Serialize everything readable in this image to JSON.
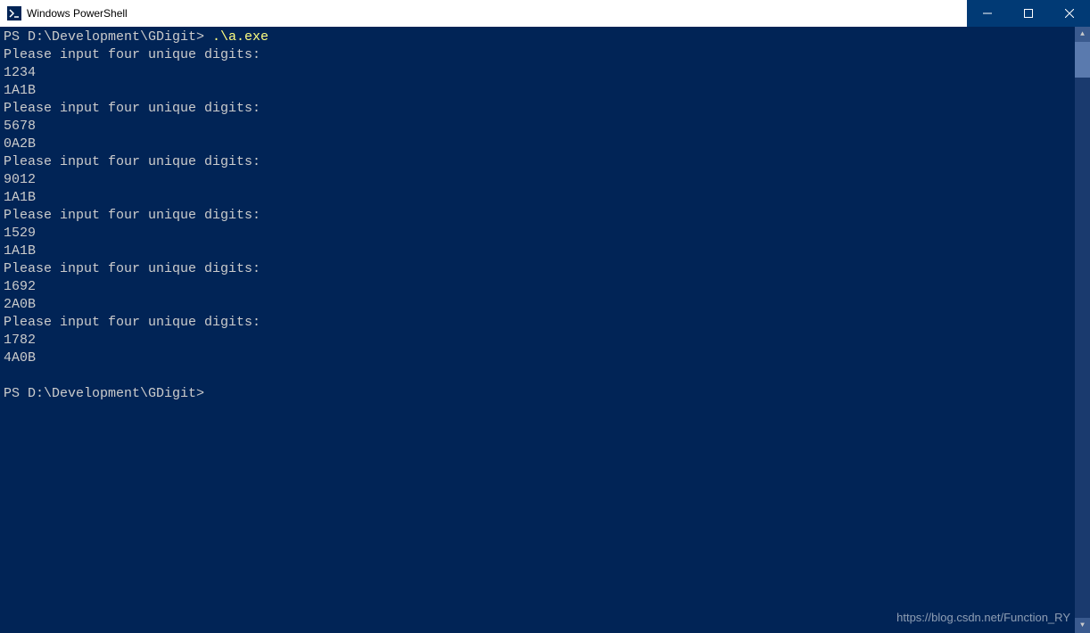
{
  "window": {
    "title": "Windows PowerShell"
  },
  "terminal": {
    "prompt1_prefix": "PS D:\\Development\\GDigit> ",
    "command1": ".\\a.exe",
    "lines": [
      "Please input four unique digits:",
      "1234",
      "1A1B",
      "Please input four unique digits:",
      "5678",
      "0A2B",
      "Please input four unique digits:",
      "9012",
      "1A1B",
      "Please input four unique digits:",
      "1529",
      "1A1B",
      "Please input four unique digits:",
      "1692",
      "2A0B",
      "Please input four unique digits:",
      "1782",
      "4A0B",
      ""
    ],
    "prompt2": "PS D:\\Development\\GDigit> "
  },
  "watermark": "https://blog.csdn.net/Function_RY"
}
